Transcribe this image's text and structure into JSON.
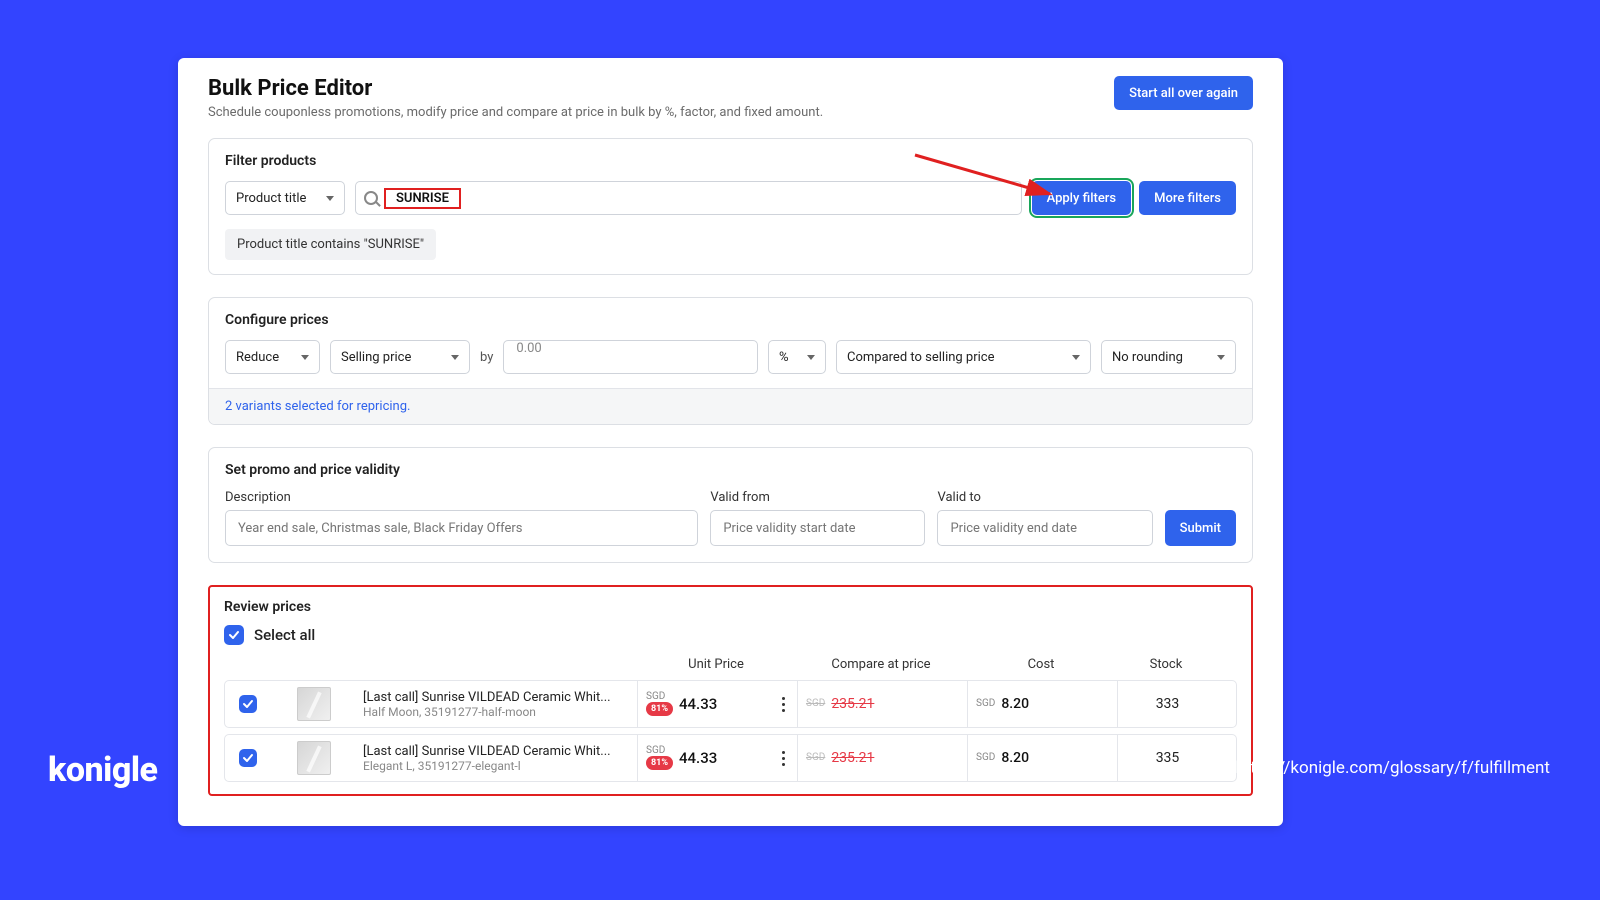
{
  "header": {
    "title": "Bulk Price Editor",
    "subtitle": "Schedule couponless promotions, modify price and compare at price in bulk by %, factor, and fixed amount.",
    "reset_button": "Start all over again"
  },
  "filter": {
    "title": "Filter products",
    "attr_select": "Product title",
    "search_value": "SUNRISE",
    "apply_button": "Apply filters",
    "more_button": "More filters",
    "chip": "Product title contains \"SUNRISE\""
  },
  "configure": {
    "title": "Configure prices",
    "action_select": "Reduce",
    "target_select": "Selling price",
    "by_label": "by",
    "amount": "0.00",
    "unit": "%",
    "compare_select": "Compared to selling price",
    "rounding_select": "No rounding",
    "status": "2 variants selected for repricing."
  },
  "validity": {
    "title": "Set promo and price validity",
    "description_label": "Description",
    "description_placeholder": "Year end sale, Christmas sale, Black Friday Offers",
    "valid_from_label": "Valid from",
    "valid_from_placeholder": "Price validity start date",
    "valid_to_label": "Valid to",
    "valid_to_placeholder": "Price validity end date",
    "submit_button": "Submit"
  },
  "review": {
    "title": "Review prices",
    "select_all": "Select all",
    "cols": {
      "unit": "Unit Price",
      "compare": "Compare at price",
      "cost": "Cost",
      "stock": "Stock"
    },
    "currency": "SGD",
    "discount_badge": "81%",
    "rows": [
      {
        "title": "[Last call] Sunrise VILDEAD Ceramic Whit...",
        "sub": "Half Moon, 35191277-half-moon",
        "price": "44.33",
        "compare": "235.21",
        "cost": "8.20",
        "stock": "333"
      },
      {
        "title": "[Last call] Sunrise VILDEAD Ceramic Whit...",
        "sub": "Elegant L, 35191277-elegant-l",
        "price": "44.33",
        "compare": "235.21",
        "cost": "8.20",
        "stock": "335"
      }
    ]
  },
  "footer": {
    "brand": "konigle",
    "url": "https://konigle.com/glossary/f/fulfillment"
  }
}
